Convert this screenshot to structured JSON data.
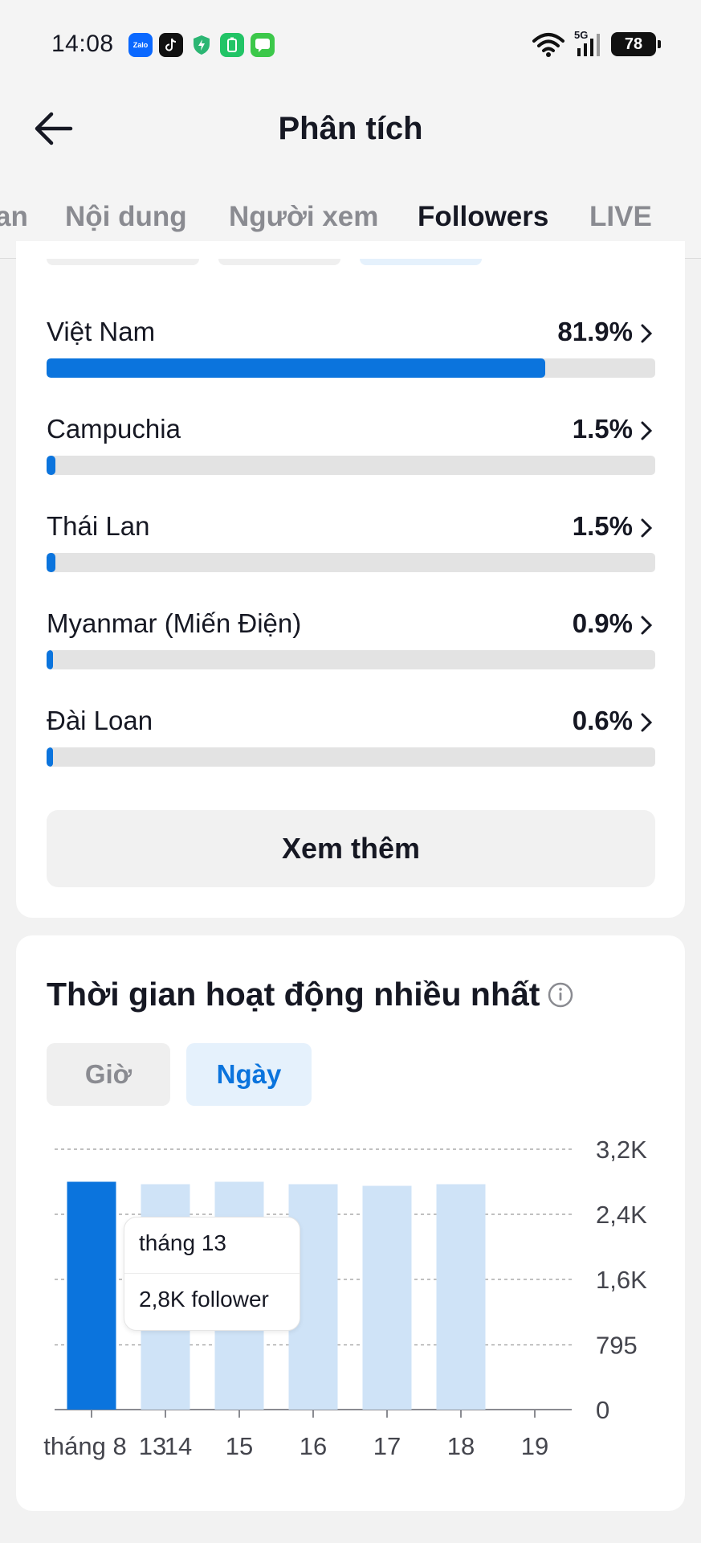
{
  "status_bar": {
    "time": "14:08",
    "network": "5G",
    "battery": "78",
    "notification_icons": [
      "zalo-icon",
      "tiktok-icon",
      "shield-icon",
      "battery-saver-icon",
      "messages-icon"
    ],
    "zalo_label": "Zalo"
  },
  "header": {
    "title": "Phân tích"
  },
  "tabs": [
    {
      "label": "Tổng quan",
      "visible_label": "an",
      "active": false
    },
    {
      "label": "Nội dung",
      "active": false
    },
    {
      "label": "Người xem",
      "active": false
    },
    {
      "label": "Followers",
      "active": true
    },
    {
      "label": "LIVE",
      "active": false
    }
  ],
  "countries": {
    "items": [
      {
        "name": "Việt Nam",
        "percent_label": "81.9%",
        "fraction": 0.819
      },
      {
        "name": "Campuchia",
        "percent_label": "1.5%",
        "fraction": 0.015
      },
      {
        "name": "Thái Lan",
        "percent_label": "1.5%",
        "fraction": 0.015
      },
      {
        "name": "Myanmar (Miến Điện)",
        "percent_label": "0.9%",
        "fraction": 0.009
      },
      {
        "name": "Đài Loan",
        "percent_label": "0.6%",
        "fraction": 0.006
      }
    ],
    "more_button": "Xem thêm"
  },
  "activity": {
    "title": "Thời gian hoạt động nhiều nhất",
    "toggle": {
      "hour_label": "Giờ",
      "day_label": "Ngày",
      "selected": "Ngày"
    },
    "tooltip": {
      "line1": "tháng 13",
      "line2": "2,8K follower"
    }
  },
  "colors": {
    "accent": "#0b74dd",
    "bar_light": "#cfe3f7",
    "track": "#e3e3e3"
  },
  "chart_data": {
    "type": "bar",
    "categories": [
      "tháng 8 13",
      "14",
      "15",
      "16",
      "17",
      "18",
      "19"
    ],
    "x_tick_labels": [
      "tháng 8",
      "13",
      "14",
      "15",
      "16",
      "17",
      "18",
      "19"
    ],
    "values": [
      2800,
      2770,
      2800,
      2770,
      2750,
      2770,
      0
    ],
    "highlighted_index": 0,
    "y_ticks": [
      0,
      795,
      1600,
      2400,
      3200
    ],
    "y_tick_labels": [
      "0",
      "795",
      "1,6K",
      "2,4K",
      "3,2K"
    ],
    "ylim": [
      0,
      3200
    ],
    "grid": true,
    "y_axis_position": "right"
  }
}
